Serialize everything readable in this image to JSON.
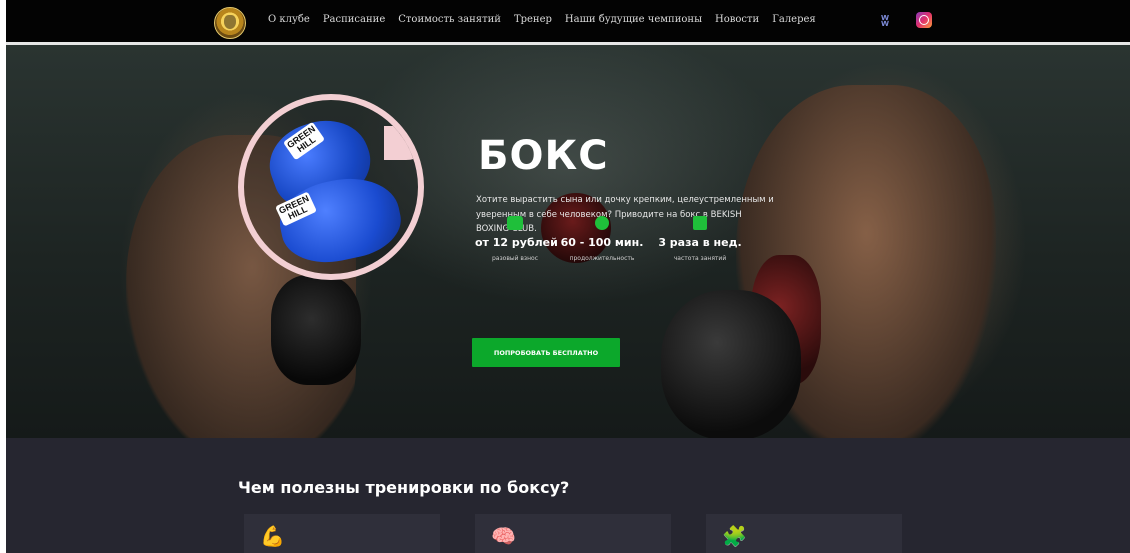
{
  "nav": {
    "menu": [
      "О клубе",
      "Расписание",
      "Стоимость занятий",
      "Тренер",
      "Наши будущие чемпионы",
      "Новости",
      "Галерея"
    ],
    "vk_label": "VK"
  },
  "hero": {
    "title": "БОКС",
    "description": "Хотите вырастить сына или дочку крепким, целеустремленным и уверенным в себе человеком? Приводите на бокс в BEKISH BOXING CLUB.",
    "glove_brand": [
      "GREEN",
      "HILL"
    ],
    "stats": [
      {
        "value": "от 12 рублей",
        "caption": "разовый взнос",
        "icon": "wallet-icon",
        "color": "#1fbf3a"
      },
      {
        "value": "60 - 100 мин.",
        "caption": "продолжительность",
        "icon": "clock-icon",
        "color": "#1fbf3a"
      },
      {
        "value": "3 раза в нед.",
        "caption": "частота занятий",
        "icon": "calendar-icon",
        "color": "#1fbf3a"
      }
    ],
    "cta_label": "ПОПРОБОВАТЬ БЕСПЛАТНО"
  },
  "benefits": {
    "title": "Чем полезны тренировки по боксу?",
    "cards": [
      {
        "icon": "muscle-arm-icon"
      },
      {
        "icon": "brain-icon"
      },
      {
        "icon": "puzzle-icon"
      }
    ]
  },
  "colors": {
    "nav_bg": "#030303",
    "accent_green": "#0ca82b",
    "section_bg": "#262630",
    "circle_border": "#f3cfd3"
  }
}
